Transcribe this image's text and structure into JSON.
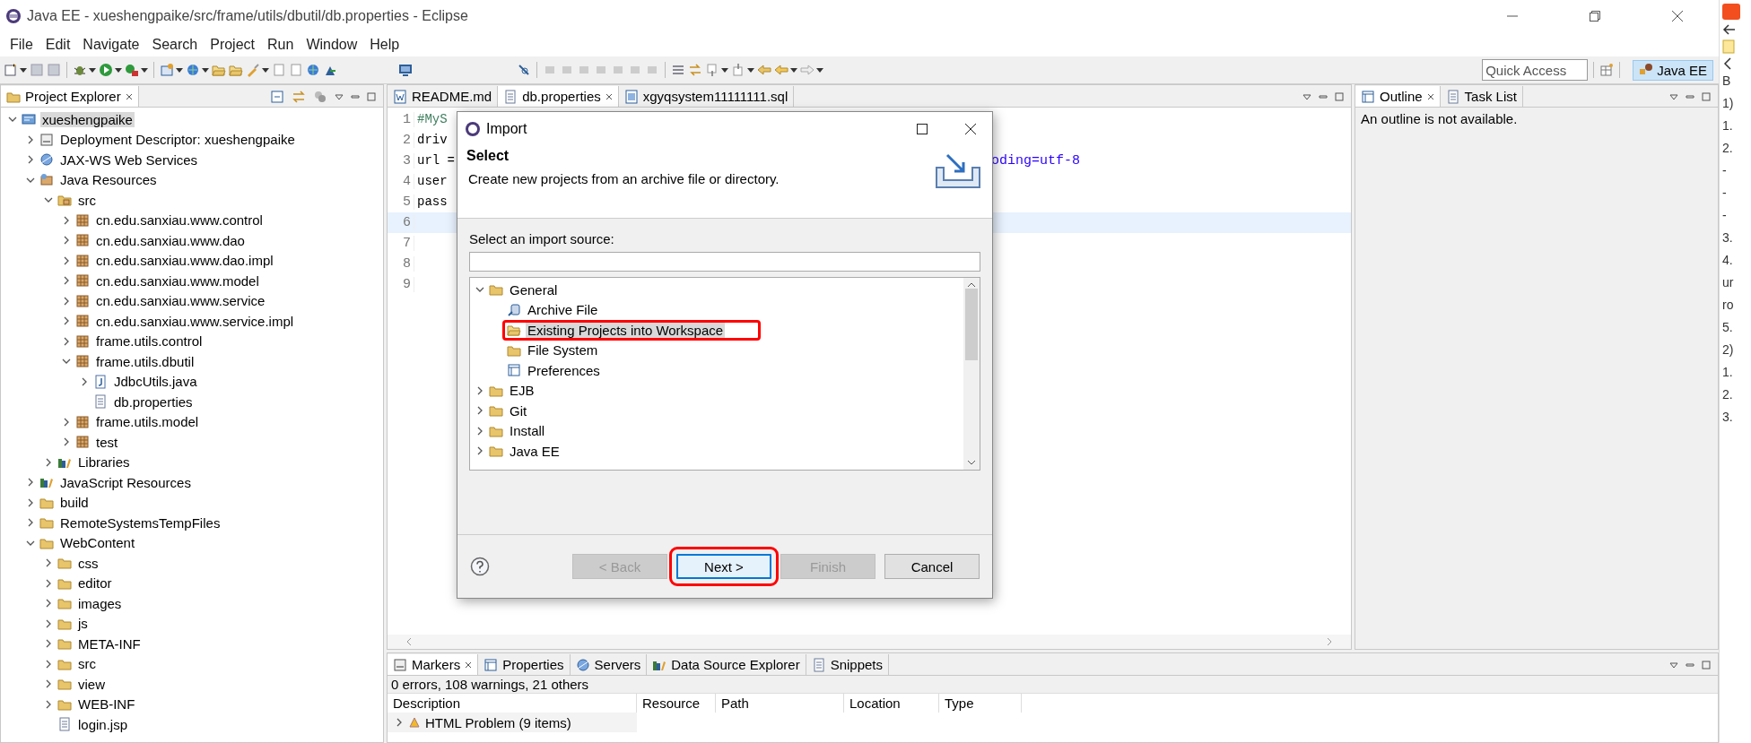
{
  "window": {
    "title": "Java EE - xueshengpaike/src/frame/utils/dbutil/db.properties - Eclipse"
  },
  "menu": [
    "File",
    "Edit",
    "Navigate",
    "Search",
    "Project",
    "Run",
    "Window",
    "Help"
  ],
  "quick_access": {
    "placeholder": "Quick Access"
  },
  "perspective": {
    "label": "Java EE",
    "selected": true
  },
  "project_explorer": {
    "title": "Project Explorer",
    "items": [
      {
        "label": "xueshengpaike",
        "kind": "project",
        "expanded": true,
        "selected": true,
        "children": [
          {
            "label": "Deployment Descriptor: xueshengpaike",
            "kind": "descriptor",
            "expanded": false,
            "selected": false
          },
          {
            "label": "JAX-WS Web Services",
            "kind": "webservice",
            "expanded": false,
            "selected": false
          },
          {
            "label": "Java Resources",
            "kind": "javares",
            "expanded": true,
            "selected": false,
            "children": [
              {
                "label": "src",
                "kind": "srcfolder",
                "expanded": true,
                "selected": false,
                "children": [
                  {
                    "label": "cn.edu.sanxiau.www.control",
                    "kind": "package",
                    "expanded": false,
                    "selected": false
                  },
                  {
                    "label": "cn.edu.sanxiau.www.dao",
                    "kind": "package",
                    "expanded": false,
                    "selected": false
                  },
                  {
                    "label": "cn.edu.sanxiau.www.dao.impl",
                    "kind": "package",
                    "expanded": false,
                    "selected": false
                  },
                  {
                    "label": "cn.edu.sanxiau.www.model",
                    "kind": "package",
                    "expanded": false,
                    "selected": false
                  },
                  {
                    "label": "cn.edu.sanxiau.www.service",
                    "kind": "package",
                    "expanded": false,
                    "selected": false
                  },
                  {
                    "label": "cn.edu.sanxiau.www.service.impl",
                    "kind": "package",
                    "expanded": false,
                    "selected": false
                  },
                  {
                    "label": "frame.utils.control",
                    "kind": "package",
                    "expanded": false,
                    "selected": false
                  },
                  {
                    "label": "frame.utils.dbutil",
                    "kind": "package",
                    "expanded": true,
                    "selected": false,
                    "children": [
                      {
                        "label": "JdbcUtils.java",
                        "kind": "java",
                        "expanded": false,
                        "selected": false
                      },
                      {
                        "label": "db.properties",
                        "kind": "textfile",
                        "selected": false
                      }
                    ]
                  },
                  {
                    "label": "frame.utils.model",
                    "kind": "package",
                    "expanded": false,
                    "selected": false
                  },
                  {
                    "label": "test",
                    "kind": "package",
                    "expanded": false,
                    "selected": false
                  }
                ]
              },
              {
                "label": "Libraries",
                "kind": "library",
                "expanded": false,
                "selected": false
              }
            ]
          },
          {
            "label": "JavaScript Resources",
            "kind": "library",
            "expanded": false,
            "selected": false
          },
          {
            "label": "build",
            "kind": "folder",
            "expanded": false,
            "selected": false
          },
          {
            "label": "RemoteSystemsTempFiles",
            "kind": "folder",
            "expanded": false,
            "selected": false
          },
          {
            "label": "WebContent",
            "kind": "folder",
            "expanded": true,
            "selected": false,
            "children": [
              {
                "label": "css",
                "kind": "folder",
                "expanded": false,
                "selected": false
              },
              {
                "label": "editor",
                "kind": "folder",
                "expanded": false,
                "selected": false
              },
              {
                "label": "images",
                "kind": "folder",
                "expanded": false,
                "selected": false
              },
              {
                "label": "js",
                "kind": "folder",
                "expanded": false,
                "selected": false
              },
              {
                "label": "META-INF",
                "kind": "folder",
                "expanded": false,
                "selected": false
              },
              {
                "label": "src",
                "kind": "folder",
                "expanded": false,
                "selected": false
              },
              {
                "label": "view",
                "kind": "folder",
                "expanded": false,
                "selected": false
              },
              {
                "label": "WEB-INF",
                "kind": "folder",
                "expanded": false,
                "selected": false
              },
              {
                "label": "login.jsp",
                "kind": "textfile",
                "selected": false
              }
            ]
          }
        ]
      }
    ]
  },
  "editor": {
    "tabs": [
      {
        "label": "README.md",
        "kind": "word",
        "selected": false
      },
      {
        "label": "db.properties",
        "kind": "textfile",
        "selected": true
      },
      {
        "label": "xgyqsystem11111111.sql",
        "kind": "sql",
        "selected": false
      }
    ],
    "lines": [
      {
        "number": "1",
        "text": "#MyS",
        "kind": "comment",
        "current": false
      },
      {
        "number": "2",
        "text": "driv",
        "kind": "plain",
        "current": false
      },
      {
        "number": "3",
        "text": "url =",
        "kind": "plain",
        "current": false,
        "tail": "oding=utf-8"
      },
      {
        "number": "4",
        "text": "user",
        "kind": "plain",
        "current": false
      },
      {
        "number": "5",
        "text": "pass",
        "kind": "plain",
        "current": false
      },
      {
        "number": "6",
        "current": true
      },
      {
        "number": "7",
        "current": false
      },
      {
        "number": "8",
        "current": false
      },
      {
        "number": "9",
        "current": false
      }
    ]
  },
  "outline": {
    "tabs": [
      {
        "label": "Outline",
        "selected": true
      },
      {
        "label": "Task List",
        "selected": false
      }
    ],
    "message": "An outline is not available."
  },
  "markers": {
    "tabs": [
      {
        "label": "Markers",
        "selected": true
      },
      {
        "label": "Properties",
        "selected": false
      },
      {
        "label": "Servers",
        "selected": false
      },
      {
        "label": "Data Source Explorer",
        "selected": false
      },
      {
        "label": "Snippets",
        "selected": false
      }
    ],
    "summary": "0 errors, 108 warnings, 21 others",
    "columns": [
      "Description",
      "Resource",
      "Path",
      "Location",
      "Type"
    ],
    "rows": [
      {
        "description": "HTML Problem (9 items)",
        "expanded": false
      }
    ]
  },
  "dialog": {
    "title": "Import",
    "heading": "Select",
    "description": "Create new projects from an archive file or directory.",
    "source_label": "Select an import source:",
    "items": [
      {
        "label": "General",
        "kind": "folder",
        "expanded": true,
        "selected": false,
        "annotated": false,
        "children": [
          {
            "label": "Archive File",
            "kind": "archive",
            "selected": false,
            "annotated": false
          },
          {
            "label": "Existing Projects into Workspace",
            "kind": "openfolder",
            "selected": true,
            "annotated": true
          },
          {
            "label": "File System",
            "kind": "folder",
            "selected": false,
            "annotated": false
          },
          {
            "label": "Preferences",
            "kind": "prefs",
            "selected": false,
            "annotated": false
          }
        ]
      },
      {
        "label": "EJB",
        "kind": "folder",
        "expanded": false,
        "selected": false,
        "annotated": false
      },
      {
        "label": "Git",
        "kind": "folder",
        "expanded": false,
        "selected": false,
        "annotated": false
      },
      {
        "label": "Install",
        "kind": "folder",
        "expanded": false,
        "selected": false,
        "annotated": false
      },
      {
        "label": "Java EE",
        "kind": "folder",
        "expanded": false,
        "selected": false,
        "annotated": false
      }
    ],
    "buttons": [
      {
        "label": "< Back",
        "disabled": true,
        "default": false,
        "annotated": false
      },
      {
        "label": "Next >",
        "disabled": false,
        "default": true,
        "annotated": true
      },
      {
        "label": "Finish",
        "disabled": true,
        "default": false,
        "annotated": false
      },
      {
        "label": "Cancel",
        "disabled": false,
        "default": false,
        "annotated": false
      }
    ]
  },
  "side_strip": [
    "B",
    "1)",
    "1.",
    "2.",
    "-",
    "-",
    "-",
    "3.",
    "4.",
    "ur",
    "ro",
    "5.",
    "2)",
    "1.",
    "2.",
    "3."
  ]
}
